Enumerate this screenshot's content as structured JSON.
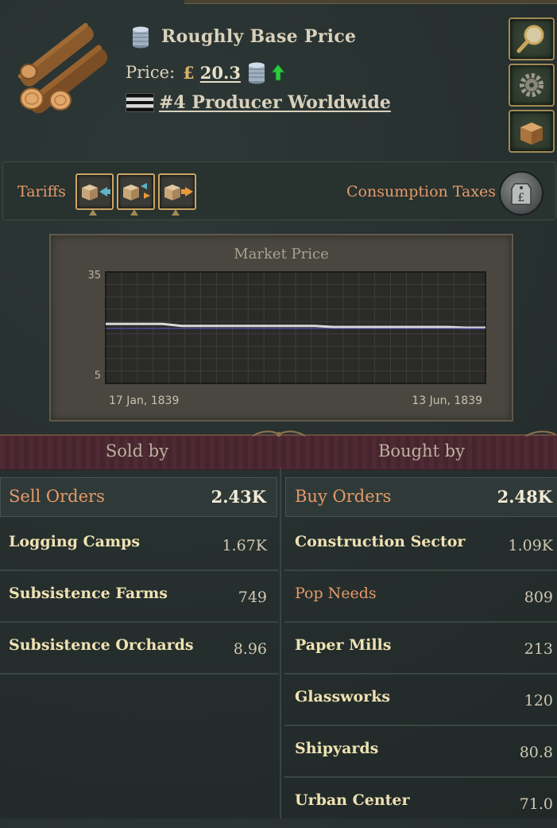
{
  "header": {
    "price_status": "Roughly Base Price",
    "price_label": "Price:",
    "currency_symbol": "£",
    "price_value": "20.3",
    "producer_rank": "#4 Producer Worldwide"
  },
  "tariffs": {
    "label": "Tariffs",
    "consumption_label": "Consumption Taxes"
  },
  "chart_data": {
    "type": "line",
    "title": "Market Price",
    "x_start_label": "17 Jan, 1839",
    "x_end_label": "13 Jun, 1839",
    "ylim": [
      5,
      35
    ],
    "y_ticks": [
      "35",
      "5"
    ],
    "grid": true,
    "series": [
      {
        "color": "#d9d9d9",
        "values": [
          21.0,
          21.0,
          21.0,
          21.0,
          20.5,
          20.5,
          20.5,
          20.5,
          20.5,
          20.5,
          20.5,
          20.5,
          20.2,
          20.2,
          20.2,
          20.2,
          20.2,
          20.2,
          20.2,
          20.0,
          20.0
        ]
      },
      {
        "color": "#5a5ad8",
        "values": [
          19.8,
          19.8,
          19.8,
          19.8,
          19.8,
          19.8,
          19.8,
          19.8,
          19.8,
          19.8,
          19.8,
          19.8,
          19.8,
          19.8,
          19.8,
          19.8,
          19.8,
          19.8,
          19.8,
          19.8,
          19.8
        ]
      }
    ]
  },
  "sold_by": {
    "header": "Sold by",
    "orders_label": "Sell Orders",
    "orders_total": "2.43K",
    "rows": [
      {
        "name": "Logging Camps",
        "value": "1.67K"
      },
      {
        "name": "Subsistence Farms",
        "value": "749"
      },
      {
        "name": "Subsistence Orchards",
        "value": "8.96"
      }
    ]
  },
  "bought_by": {
    "header": "Bought by",
    "orders_label": "Buy Orders",
    "orders_total": "2.48K",
    "rows": [
      {
        "name": "Construction Sector",
        "value": "1.09K"
      },
      {
        "name": "Pop Needs",
        "value": "809"
      },
      {
        "name": "Paper Mills",
        "value": "213"
      },
      {
        "name": "Glassworks",
        "value": "120"
      },
      {
        "name": "Shipyards",
        "value": "80.8"
      },
      {
        "name": "Urban Center",
        "value": "71.0"
      }
    ]
  },
  "icons": {
    "goods": "wood-logs-icon",
    "coins": "coin-stack-icon",
    "price_trend": "arrow-up-icon",
    "flag": "country-flag-icon",
    "side_buttons": [
      "magnifier-icon",
      "gear-icon",
      "goods-crate-icon"
    ],
    "tariff_buttons": [
      "import-tariff-icon",
      "no-tariff-icon",
      "export-tariff-icon"
    ],
    "tax": "price-tag-pound-icon"
  },
  "colors": {
    "accent_orange": "#e59a6a",
    "header_band": "#4b2630",
    "price_up_arrow": "#2ecc40"
  }
}
